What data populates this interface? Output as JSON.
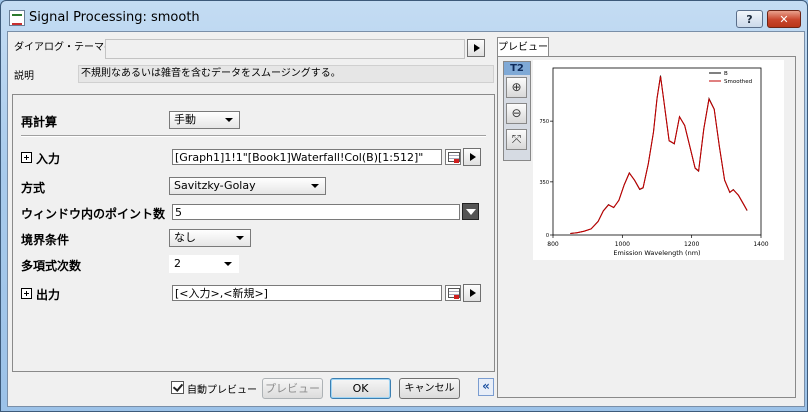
{
  "window": {
    "title": "Signal Processing: smooth"
  },
  "theme": {
    "label": "ダイアログ・テーマ(H)",
    "value": ""
  },
  "description": {
    "label": "説明",
    "text": "不規則なあるいは雑音を含むデータをスムージングする。"
  },
  "fields": {
    "recalculate": {
      "label": "再計算",
      "value": "手動"
    },
    "input": {
      "label": "入力",
      "value": "[Graph1]1!1\"[Book1]Waterfall!Col(B)[1:512]\""
    },
    "method": {
      "label": "方式",
      "value": "Savitzky-Golay"
    },
    "points": {
      "label": "ウィンドウ内のポイント数",
      "value": "5"
    },
    "boundary": {
      "label": "境界条件",
      "value": "なし"
    },
    "polyorder": {
      "label": "多項式次数",
      "value": "2"
    },
    "output": {
      "label": "出力",
      "value": "[<入力>,<新規>]"
    }
  },
  "footer": {
    "auto_preview_label": "自動プレビュー",
    "auto_preview_checked": true,
    "preview_button": "プレビュー",
    "ok_button": "OK",
    "cancel_button": "キャンセル"
  },
  "preview": {
    "tab_label": "プレビュー",
    "toolbar_badge": "T2",
    "tools": [
      "zoom-in-icon",
      "zoom-out-icon",
      "rescale-icon"
    ]
  },
  "chart_data": {
    "type": "line",
    "xlabel": "Emission Wavelength (nm)",
    "ylabel": "",
    "xlim": [
      800,
      1400
    ],
    "ylim": [
      0,
      1100
    ],
    "xticks": [
      800,
      1000,
      1200,
      1400
    ],
    "yticks": [
      0,
      350,
      750
    ],
    "grid": false,
    "legend_position": "top-right",
    "series": [
      {
        "name": "B",
        "color": "#000000",
        "x": [
          850,
          870,
          890,
          910,
          930,
          945,
          960,
          975,
          990,
          1005,
          1020,
          1035,
          1050,
          1060,
          1075,
          1090,
          1100,
          1110,
          1120,
          1135,
          1150,
          1165,
          1180,
          1195,
          1210,
          1220,
          1235,
          1250,
          1265,
          1280,
          1295,
          1310,
          1320,
          1335,
          1350,
          1360
        ],
        "y": [
          10,
          15,
          25,
          40,
          90,
          160,
          200,
          180,
          230,
          330,
          410,
          360,
          300,
          310,
          470,
          680,
          900,
          1050,
          880,
          620,
          600,
          780,
          720,
          580,
          440,
          420,
          700,
          900,
          830,
          580,
          360,
          280,
          300,
          260,
          200,
          160
        ]
      },
      {
        "name": "Smoothed",
        "color": "#c00000",
        "x": [
          850,
          870,
          890,
          910,
          930,
          945,
          960,
          975,
          990,
          1005,
          1020,
          1035,
          1050,
          1060,
          1075,
          1090,
          1100,
          1110,
          1120,
          1135,
          1150,
          1165,
          1180,
          1195,
          1210,
          1220,
          1235,
          1250,
          1265,
          1280,
          1295,
          1310,
          1320,
          1335,
          1350,
          1360
        ],
        "y": [
          10,
          15,
          25,
          40,
          88,
          158,
          198,
          182,
          228,
          328,
          408,
          362,
          302,
          312,
          468,
          678,
          898,
          1045,
          882,
          622,
          602,
          778,
          722,
          582,
          442,
          422,
          698,
          895,
          828,
          582,
          362,
          282,
          298,
          262,
          202,
          162
        ]
      }
    ]
  }
}
